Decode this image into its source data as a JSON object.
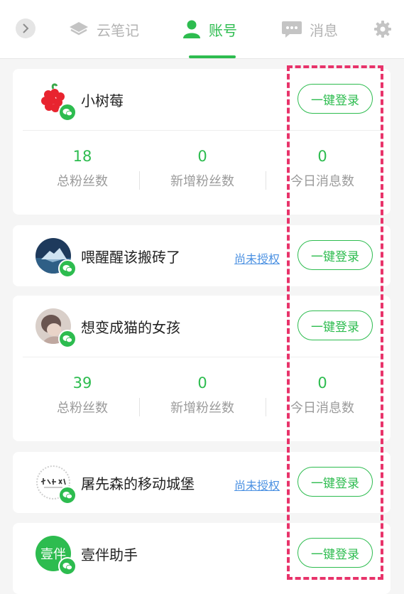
{
  "header": {
    "tabs": [
      {
        "label": "云笔记",
        "icon": "layers-icon",
        "active": false
      },
      {
        "label": "账号",
        "icon": "user-icon",
        "active": true
      },
      {
        "label": "消息",
        "icon": "chat-icon",
        "active": false
      }
    ]
  },
  "colors": {
    "accent": "#2dbc4f",
    "link": "#4a90e2",
    "highlight": "#e8336a"
  },
  "accounts": [
    {
      "name": "小树莓",
      "login_label": "一键登录",
      "stats": [
        {
          "value": "18",
          "label": "总粉丝数"
        },
        {
          "value": "0",
          "label": "新增粉丝数"
        },
        {
          "value": "0",
          "label": "今日消息数"
        }
      ]
    },
    {
      "name": "喂醒醒该搬砖了",
      "unauth_label": "尚未授权",
      "login_label": "一键登录"
    },
    {
      "name": "想变成猫的女孩",
      "login_label": "一键登录",
      "stats": [
        {
          "value": "39",
          "label": "总粉丝数"
        },
        {
          "value": "0",
          "label": "新增粉丝数"
        },
        {
          "value": "0",
          "label": "今日消息数"
        }
      ]
    },
    {
      "name": "屠先森的移动城堡",
      "unauth_label": "尚未授权",
      "login_label": "一键登录"
    },
    {
      "name": "壹伴助手",
      "avatar_text": "壹伴",
      "login_label": "一键登录"
    }
  ]
}
